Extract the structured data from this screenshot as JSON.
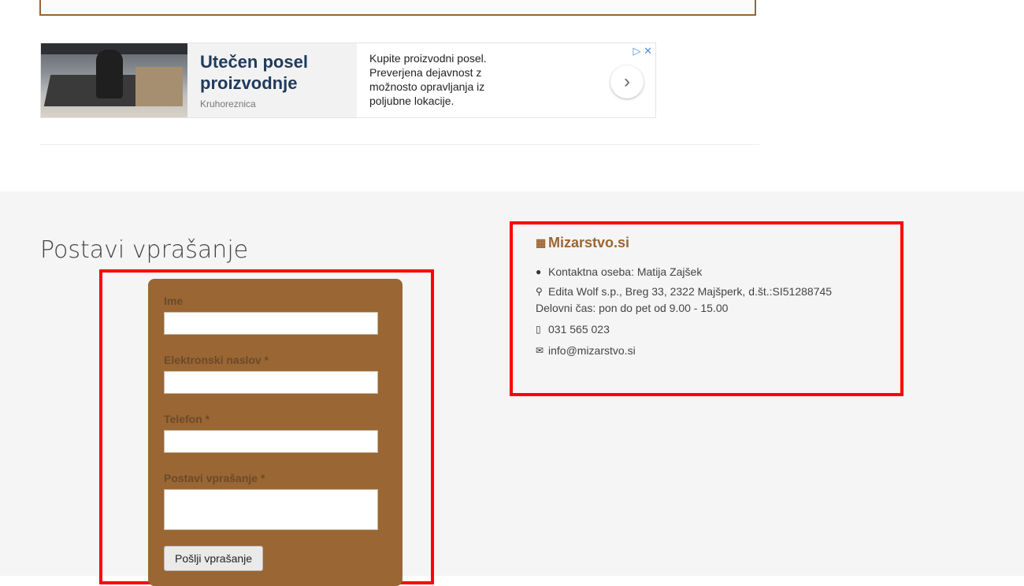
{
  "ad": {
    "title": "Utečen posel proizvodnje",
    "advertiser": "Kruhoreznica",
    "text": "Kupite proizvodni posel. Preverjena dejavnost z možnosto opravljanja iz poljubne lokacije.",
    "adchoices": "▷ ✕",
    "arrow": "›"
  },
  "form": {
    "heading": "Postavi vprašanje",
    "name_label": "Ime",
    "email_label": "Elektronski naslov *",
    "phone_label": "Telefon *",
    "question_label": "Postavi vprašanje *",
    "submit_label": "Pošlji vprašanje"
  },
  "contact": {
    "company": "Mizarstvo.si",
    "person": "Kontaktna oseba: Matija Zajšek",
    "address": "Edita Wolf s.p., Breg 33, 2322 Majšperk, d.št.:SI51288745",
    "hours": "Delovni čas: pon do pet od 9.00 - 15.00",
    "phone": "031 565 023",
    "email": "info@mizarstvo.si",
    "icons": [
      "building-icon",
      "user-icon",
      "map-marker-icon",
      "phone-icon",
      "envelope-icon"
    ]
  },
  "colors": {
    "brand": "#9a6633",
    "highlight": "#ff0000"
  }
}
